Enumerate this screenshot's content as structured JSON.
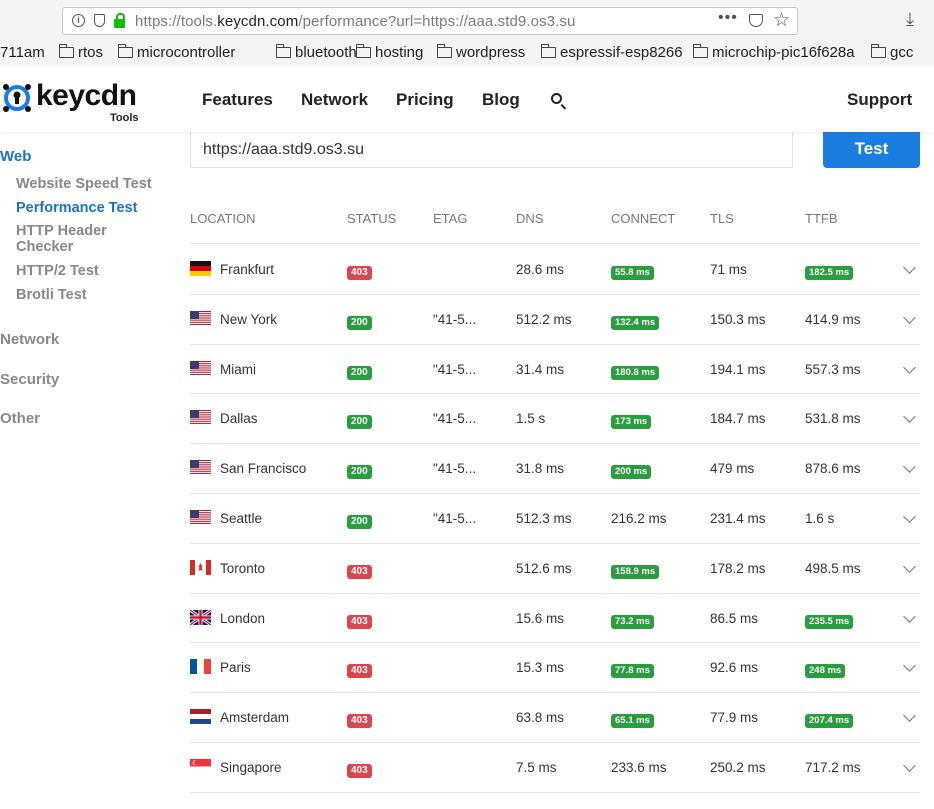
{
  "browser": {
    "url_prefix": "https://tools.",
    "url_domain": "keycdn.com",
    "url_suffix": "/performance?url=https://aaa.std9.os3.su",
    "more": "•••"
  },
  "bookmarks": [
    {
      "label": "711am",
      "folder": false
    },
    {
      "label": "rtos",
      "folder": true
    },
    {
      "label": "microcontroller",
      "folder": true
    },
    {
      "label": "bluetooth",
      "folder": true
    },
    {
      "label": "hosting",
      "folder": true
    },
    {
      "label": "wordpress",
      "folder": true
    },
    {
      "label": "espressif-esp8266",
      "folder": true
    },
    {
      "label": "microchip-pic16f628a",
      "folder": true
    },
    {
      "label": "gcc",
      "folder": true
    }
  ],
  "header": {
    "logo_text": "keycdn",
    "logo_sub": "Tools",
    "nav": [
      "Features",
      "Network",
      "Pricing",
      "Blog"
    ],
    "support": "Support"
  },
  "sidebar": {
    "web": "Web",
    "items": [
      "Website Speed Test",
      "Performance Test",
      "HTTP Header Checker",
      "HTTP/2 Test",
      "Brotli Test"
    ],
    "network": "Network",
    "security": "Security",
    "other": "Other"
  },
  "form": {
    "url_value": "https://aaa.std9.os3.su",
    "test_button": "Test"
  },
  "table": {
    "headers": [
      "LOCATION",
      "STATUS",
      "ETAG",
      "DNS",
      "CONNECT",
      "TLS",
      "TTFB"
    ],
    "rows": [
      {
        "location": "Frankfurt",
        "flag": "de",
        "status": "403",
        "etag": "",
        "dns": "28.6 ms",
        "connect": "55.8 ms",
        "connect_fast": true,
        "tls": "71 ms",
        "ttfb": "182.5 ms",
        "ttfb_fast": true
      },
      {
        "location": "New York",
        "flag": "us",
        "status": "200",
        "etag": "\"41-5...",
        "dns": "512.2 ms",
        "connect": "132.4 ms",
        "connect_fast": true,
        "tls": "150.3 ms",
        "ttfb": "414.9 ms",
        "ttfb_fast": false
      },
      {
        "location": "Miami",
        "flag": "us",
        "status": "200",
        "etag": "\"41-5...",
        "dns": "31.4 ms",
        "connect": "180.8 ms",
        "connect_fast": true,
        "tls": "194.1 ms",
        "ttfb": "557.3 ms",
        "ttfb_fast": false
      },
      {
        "location": "Dallas",
        "flag": "us",
        "status": "200",
        "etag": "\"41-5...",
        "dns": "1.5 s",
        "connect": "173 ms",
        "connect_fast": true,
        "tls": "184.7 ms",
        "ttfb": "531.8 ms",
        "ttfb_fast": false
      },
      {
        "location": "San Francisco",
        "flag": "us",
        "status": "200",
        "etag": "\"41-5...",
        "dns": "31.8 ms",
        "connect": "200 ms",
        "connect_fast": true,
        "tls": "479 ms",
        "ttfb": "878.6 ms",
        "ttfb_fast": false
      },
      {
        "location": "Seattle",
        "flag": "us",
        "status": "200",
        "etag": "\"41-5...",
        "dns": "512.3 ms",
        "connect": "216.2 ms",
        "connect_fast": false,
        "tls": "231.4 ms",
        "ttfb": "1.6 s",
        "ttfb_fast": false
      },
      {
        "location": "Toronto",
        "flag": "ca",
        "status": "403",
        "etag": "",
        "dns": "512.6 ms",
        "connect": "158.9 ms",
        "connect_fast": true,
        "tls": "178.2 ms",
        "ttfb": "498.5 ms",
        "ttfb_fast": false
      },
      {
        "location": "London",
        "flag": "gb",
        "status": "403",
        "etag": "",
        "dns": "15.6 ms",
        "connect": "73.2 ms",
        "connect_fast": true,
        "tls": "86.5 ms",
        "ttfb": "235.5 ms",
        "ttfb_fast": true
      },
      {
        "location": "Paris",
        "flag": "fr",
        "status": "403",
        "etag": "",
        "dns": "15.3 ms",
        "connect": "77.8 ms",
        "connect_fast": true,
        "tls": "92.6 ms",
        "ttfb": "248 ms",
        "ttfb_fast": true
      },
      {
        "location": "Amsterdam",
        "flag": "nl",
        "status": "403",
        "etag": "",
        "dns": "63.8 ms",
        "connect": "65.1 ms",
        "connect_fast": true,
        "tls": "77.9 ms",
        "ttfb": "207.4 ms",
        "ttfb_fast": true
      },
      {
        "location": "Singapore",
        "flag": "sg",
        "status": "403",
        "etag": "",
        "dns": "7.5 ms",
        "connect": "233.6 ms",
        "connect_fast": false,
        "tls": "250.2 ms",
        "ttfb": "717.2 ms",
        "ttfb_fast": false
      }
    ]
  },
  "colors": {
    "accent": "#1a7ee0",
    "status_ok": "#2a9d3e",
    "status_error": "#d9464f"
  }
}
